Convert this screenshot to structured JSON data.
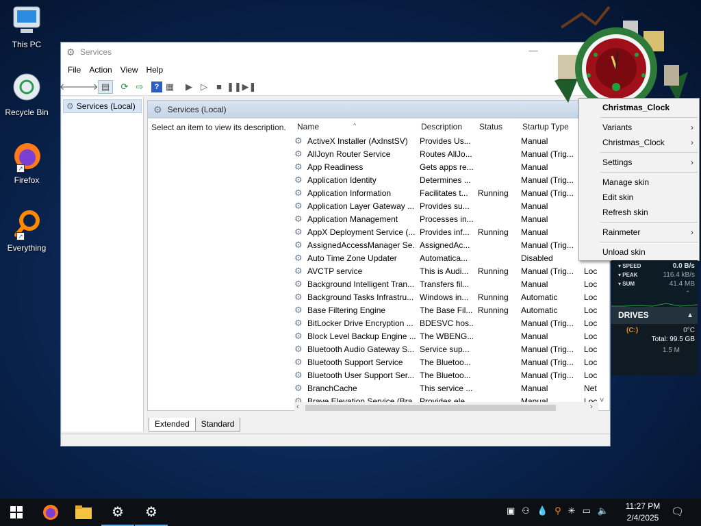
{
  "desktop": {
    "icons": [
      {
        "label": "This PC",
        "icon": "computer-icon"
      },
      {
        "label": "Recycle Bin",
        "icon": "recycle-bin-icon"
      },
      {
        "label": "Firefox",
        "icon": "firefox-icon"
      },
      {
        "label": "Everything",
        "icon": "search-magnifier-icon"
      }
    ]
  },
  "window": {
    "title": "Services",
    "menu": [
      "File",
      "Action",
      "View",
      "Help"
    ],
    "tree_root": "Services (Local)",
    "pane_title": "Services (Local)",
    "description_prompt": "Select an item to select to view its description.",
    "columns": [
      "Name",
      "Description",
      "Status",
      "Startup Type"
    ],
    "rows": [
      {
        "name": "ActiveX Installer (AxInstSV)",
        "description": "Provides Us...",
        "status": "",
        "startup": "Manual",
        "logon": ""
      },
      {
        "name": "AllJoyn Router Service",
        "description": "Routes AllJo...",
        "status": "",
        "startup": "Manual (Trig...",
        "logon": ""
      },
      {
        "name": "App Readiness",
        "description": "Gets apps re...",
        "status": "",
        "startup": "Manual",
        "logon": ""
      },
      {
        "name": "Application Identity",
        "description": "Determines ...",
        "status": "",
        "startup": "Manual (Trig...",
        "logon": ""
      },
      {
        "name": "Application Information",
        "description": "Facilitates t...",
        "status": "Running",
        "startup": "Manual (Trig...",
        "logon": ""
      },
      {
        "name": "Application Layer Gateway ...",
        "description": "Provides su...",
        "status": "",
        "startup": "Manual",
        "logon": ""
      },
      {
        "name": "Application Management",
        "description": "Processes in...",
        "status": "",
        "startup": "Manual",
        "logon": ""
      },
      {
        "name": "AppX Deployment Service (...",
        "description": "Provides inf...",
        "status": "Running",
        "startup": "Manual",
        "logon": ""
      },
      {
        "name": "AssignedAccessManager Se...",
        "description": "AssignedAc...",
        "status": "",
        "startup": "Manual (Trig...",
        "logon": ""
      },
      {
        "name": "Auto Time Zone Updater",
        "description": "Automatica...",
        "status": "",
        "startup": "Disabled",
        "logon": ""
      },
      {
        "name": "AVCTP service",
        "description": "This is Audi...",
        "status": "Running",
        "startup": "Manual (Trig...",
        "logon": "Loc"
      },
      {
        "name": "Background Intelligent Tran...",
        "description": "Transfers fil...",
        "status": "",
        "startup": "Manual",
        "logon": "Loc"
      },
      {
        "name": "Background Tasks Infrastru...",
        "description": "Windows in...",
        "status": "Running",
        "startup": "Automatic",
        "logon": "Loc"
      },
      {
        "name": "Base Filtering Engine",
        "description": "The Base Fil...",
        "status": "Running",
        "startup": "Automatic",
        "logon": "Loc"
      },
      {
        "name": "BitLocker Drive Encryption ...",
        "description": "BDESVC hos...",
        "status": "",
        "startup": "Manual (Trig...",
        "logon": "Loc"
      },
      {
        "name": "Block Level Backup Engine ...",
        "description": "The WBENG...",
        "status": "",
        "startup": "Manual",
        "logon": "Loc"
      },
      {
        "name": "Bluetooth Audio Gateway S...",
        "description": "Service sup...",
        "status": "",
        "startup": "Manual (Trig...",
        "logon": "Loc"
      },
      {
        "name": "Bluetooth Support Service",
        "description": "The Bluetoo...",
        "status": "",
        "startup": "Manual (Trig...",
        "logon": "Loc"
      },
      {
        "name": "Bluetooth User Support Ser...",
        "description": "The Bluetoo...",
        "status": "",
        "startup": "Manual (Trig...",
        "logon": "Loc"
      },
      {
        "name": "BranchCache",
        "description": "This service ...",
        "status": "",
        "startup": "Manual",
        "logon": "Net"
      },
      {
        "name": "Brave Elevation Service (Bra...",
        "description": "Provides ele...",
        "status": "",
        "startup": "Manual",
        "logon": "Loc"
      }
    ],
    "tabs": [
      "Extended",
      "Standard"
    ]
  },
  "context_menu": {
    "header": "Christmas_Clock",
    "items": [
      {
        "label": "Variants",
        "submenu": true
      },
      {
        "label": "Christmas_Clock",
        "submenu": true
      },
      {
        "label": "Settings",
        "submenu": true
      },
      {
        "label": "Manage skin",
        "submenu": false
      },
      {
        "label": "Edit skin",
        "submenu": false
      },
      {
        "label": "Refresh skin",
        "submenu": false
      },
      {
        "label": "Rainmeter",
        "submenu": true
      },
      {
        "label": "Unload skin",
        "submenu": false
      }
    ]
  },
  "network_widget": {
    "speed_label": "SPEED",
    "speed_value": "0.0 B/s",
    "peak_label": "PEAK",
    "peak_value": "116.4 kB/s",
    "sum_label": "SUM",
    "sum_value": "41.4 MB"
  },
  "drives_widget": {
    "title": "DRIVES",
    "drive": "(C:)",
    "temp": "0°C",
    "total": "Total: 99.5 GB",
    "used": "1.5 M"
  },
  "taskbar": {
    "time": "11:27 PM",
    "date": "2/4/2025"
  },
  "colors": {
    "accent": "#0078d7",
    "menu_bg": "#f2f2f2",
    "drive_label": "#f08a1c"
  }
}
